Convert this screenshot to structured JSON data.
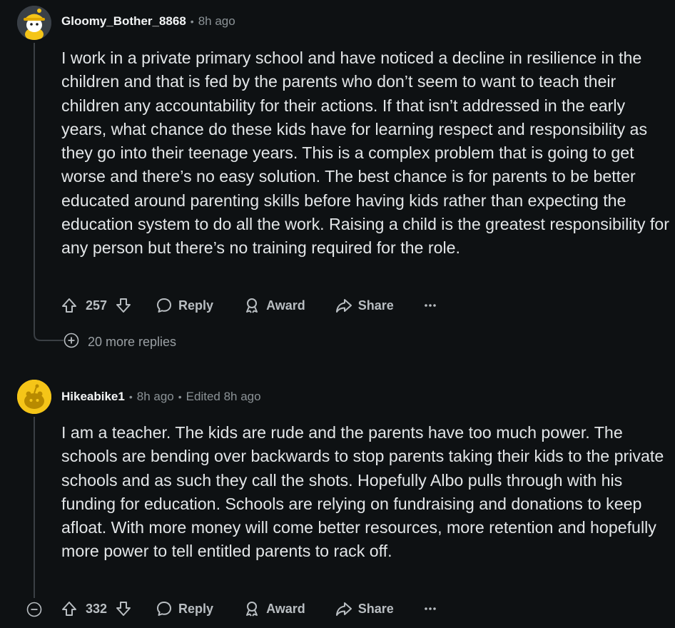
{
  "comments": [
    {
      "username": "Gloomy_Bother_8868",
      "time": "8h ago",
      "body": "I work in a private primary school and have noticed a decline in resilience in the children and that is fed by the parents who don’t seem to want to teach their children any accountability for their actions. If that isn’t addressed in the early years, what chance do these kids have for learning respect and responsibility as they go into their teenage years. This is a complex problem that is going to get worse and there’s no easy solution. The best chance is for parents to be better educated around parenting skills before having kids rather than expecting the education system to do all the work. Raising a child is the greatest responsibility for any person but there’s no training required for the role.",
      "votes": "257",
      "reply_label": "Reply",
      "award_label": "Award",
      "share_label": "Share",
      "more_replies": "20 more replies"
    },
    {
      "username": "Hikeabike1",
      "time": "8h ago",
      "edited": "Edited 8h ago",
      "body": "I am a teacher. The kids are rude and the parents have too much power. The schools are bending over backwards to stop parents taking their kids to the private schools and as such they call the shots. Hopefully Albo pulls through with his funding for education. Schools are relying on fundraising and donations to keep afloat. With more money will come better resources, more retention and hopefully more power to tell entitled parents to rack off.",
      "votes": "332",
      "reply_label": "Reply",
      "award_label": "Award",
      "share_label": "Share"
    }
  ],
  "icons": [
    "upvote-icon",
    "downvote-icon",
    "reply-icon",
    "award-icon",
    "share-icon",
    "more-options-icon",
    "expand-icon",
    "collapse-icon"
  ],
  "colors": {
    "background": "#0e1113",
    "text": "#e3e6e8",
    "muted": "#8b9296",
    "avatar_yellow": "#f5c518"
  }
}
